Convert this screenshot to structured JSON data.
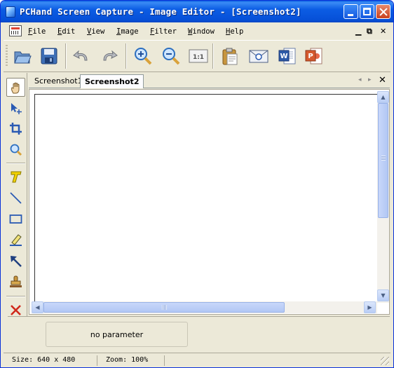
{
  "window": {
    "title": "PCHand Screen Capture - Image Editor - [Screenshot2]",
    "title_color": "#ffffff",
    "titlebar_color": "#0c5de4"
  },
  "titlebar_controls": {
    "minimize_icon": "minimize-icon",
    "maximize_icon": "maximize-icon",
    "close_icon": "close-icon"
  },
  "menubar": {
    "items": [
      {
        "label": "File"
      },
      {
        "label": "Edit"
      },
      {
        "label": "View"
      },
      {
        "label": "Image"
      },
      {
        "label": "Filter"
      },
      {
        "label": "Window"
      },
      {
        "label": "Help"
      }
    ],
    "mdi_minimize": "▁",
    "mdi_restore": "⧉",
    "mdi_close": "✕"
  },
  "toolbar": {
    "tools": [
      {
        "icon": "open-folder-icon"
      },
      {
        "icon": "save-disk-icon"
      },
      {
        "icon": "undo-icon"
      },
      {
        "icon": "redo-icon"
      },
      {
        "icon": "zoom-in-icon"
      },
      {
        "icon": "zoom-out-icon"
      },
      {
        "icon": "actual-size-icon",
        "label": "1:1"
      },
      {
        "icon": "clipboard-icon"
      },
      {
        "icon": "email-icon"
      },
      {
        "icon": "word-icon"
      },
      {
        "icon": "powerpoint-icon"
      }
    ]
  },
  "palette": {
    "tools": [
      {
        "icon": "hand-icon",
        "active": true
      },
      {
        "icon": "select-move-icon"
      },
      {
        "icon": "crop-icon"
      },
      {
        "icon": "zoom-icon"
      },
      {
        "icon": "text-icon"
      },
      {
        "icon": "line-icon"
      },
      {
        "icon": "rectangle-icon"
      },
      {
        "icon": "highlighter-icon"
      },
      {
        "icon": "arrow-icon"
      },
      {
        "icon": "stamp-icon"
      },
      {
        "icon": "delete-icon"
      }
    ]
  },
  "tabs": {
    "items": [
      {
        "label": "Screenshot1",
        "active": false
      },
      {
        "label": "Screenshot2",
        "active": true
      }
    ],
    "prev_label": "◂",
    "next_label": "▸",
    "close_label": "✕"
  },
  "scrollbars": {
    "vertical": {
      "up": "▲",
      "down": "▼"
    },
    "horizontal": {
      "left": "◀",
      "right": "▶"
    }
  },
  "parameter_panel": {
    "text": "no parameter"
  },
  "statusbar": {
    "size": "Size: 640 x 480",
    "zoom": "Zoom: 100%"
  }
}
